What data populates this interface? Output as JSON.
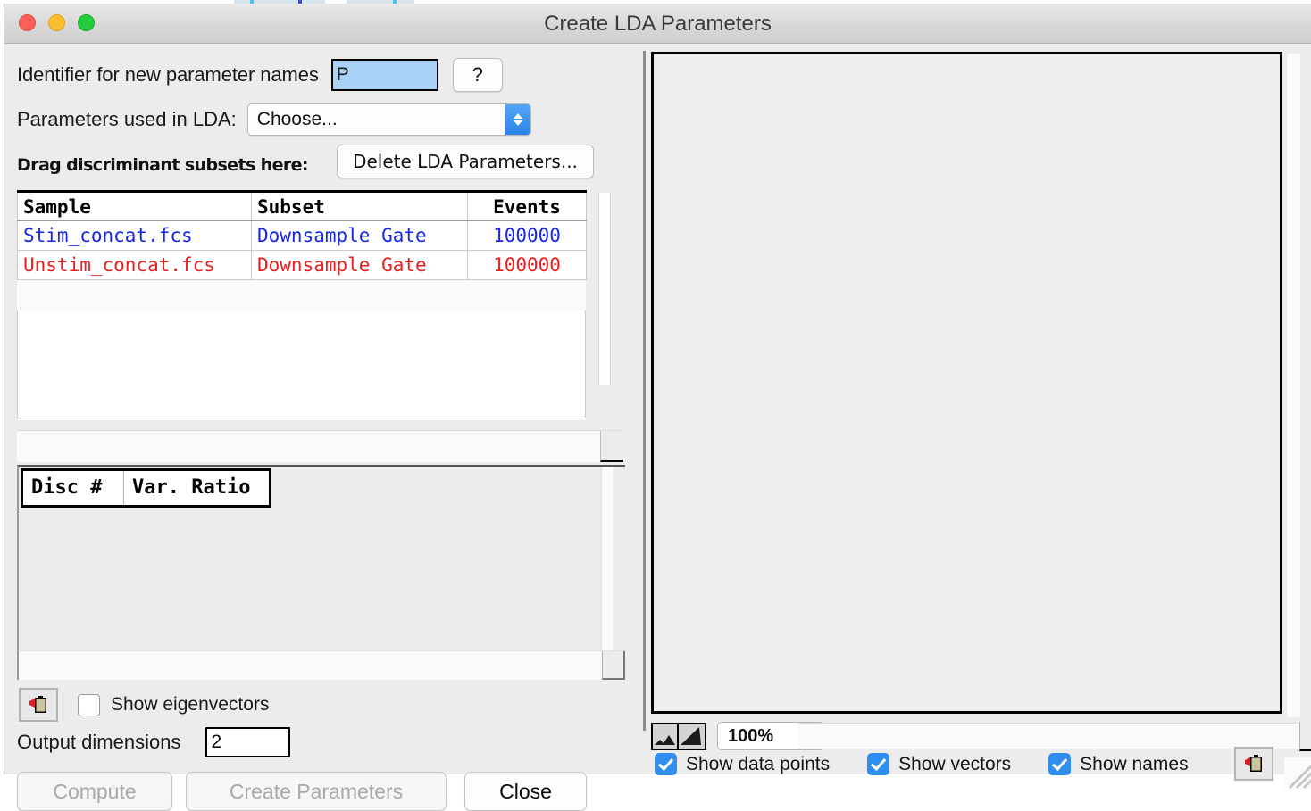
{
  "window": {
    "title": "Create LDA Parameters",
    "traffic_lights": [
      "close",
      "minimize",
      "maximize"
    ]
  },
  "left": {
    "identifier": {
      "label": "Identifier for new parameter names",
      "value": "P",
      "help_label": "?"
    },
    "parameters_used": {
      "label": "Parameters used in LDA:",
      "selected": "Choose..."
    },
    "drag_label": "Drag discriminant subsets here:",
    "delete_button": "Delete LDA Parameters...",
    "subsets_table": {
      "columns": [
        "Sample",
        "Subset",
        "Events"
      ],
      "rows": [
        {
          "sample": "Stim_concat.fcs",
          "subset": "Downsample Gate",
          "events": "100000",
          "color": "#1726e8"
        },
        {
          "sample": "Unstim_concat.fcs",
          "subset": "Downsample Gate",
          "events": "100000",
          "color": "#ee1b1b"
        }
      ]
    },
    "disc_table": {
      "columns": [
        "Disc #",
        "Var. Ratio"
      ],
      "rows": []
    },
    "show_eigenvectors": {
      "label": "Show eigenvectors",
      "checked": false
    },
    "output_dimensions": {
      "label": "Output dimensions",
      "value": "2"
    },
    "buttons": {
      "compute": "Compute",
      "create_parameters": "Create Parameters",
      "close": "Close"
    }
  },
  "right": {
    "zoom": {
      "value": "100%"
    },
    "checkboxes": [
      {
        "label": "Show data points",
        "checked": true
      },
      {
        "label": "Show vectors",
        "checked": true
      },
      {
        "label": "Show names",
        "checked": true
      }
    ]
  },
  "colors": {
    "accent_blue": "#2f8ef0",
    "row_blue": "#1726e8",
    "row_red": "#ee1b1b",
    "window_bg": "#ececec",
    "titlebar": "#d8d8d8"
  }
}
